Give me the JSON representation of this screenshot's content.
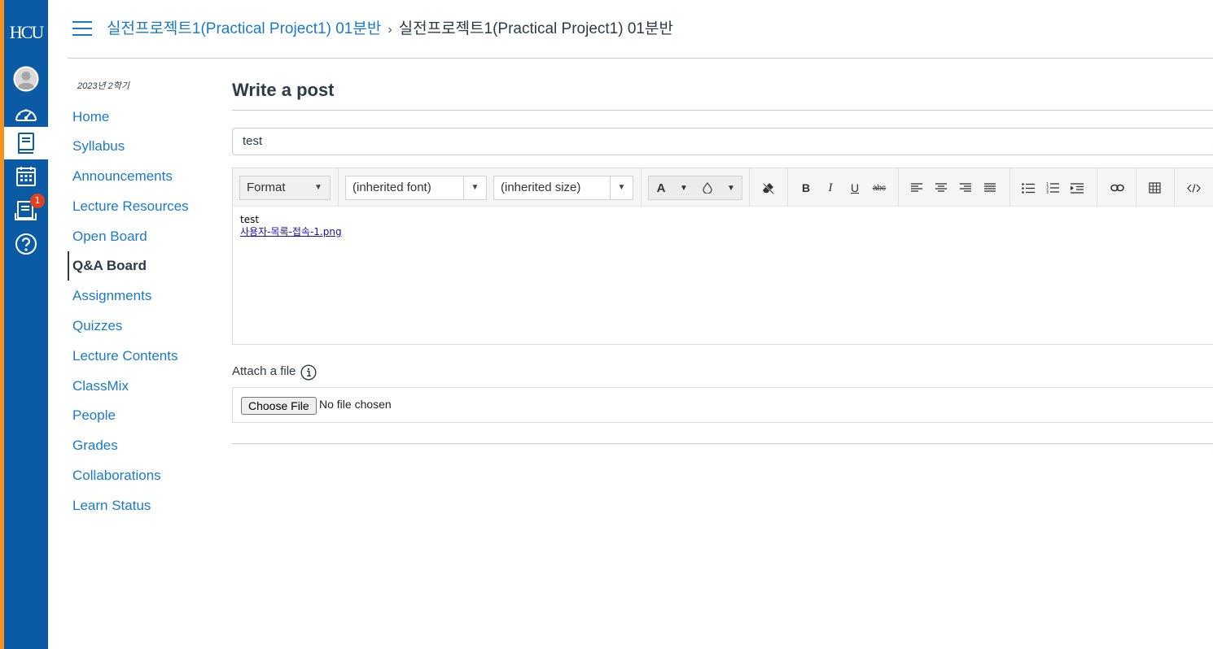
{
  "global_nav": {
    "logo": "HCU",
    "items": [
      {
        "name": "account",
        "icon": "user-avatar-icon"
      },
      {
        "name": "dashboard",
        "icon": "gauge-icon"
      },
      {
        "name": "courses",
        "icon": "book-icon",
        "active": true
      },
      {
        "name": "calendar",
        "icon": "calendar-icon"
      },
      {
        "name": "inbox",
        "icon": "inbox-icon",
        "badge": "1"
      },
      {
        "name": "help",
        "icon": "help-icon"
      }
    ],
    "colors": {
      "background": "#0a5aa5",
      "stripe": "#f5931e",
      "badge": "#e0401e"
    }
  },
  "header": {
    "breadcrumb_link": "실전프로젝트1(Practical Project1) 01분반",
    "separator": "›",
    "breadcrumb_current": "실전프로젝트1(Practical Project1) 01분반"
  },
  "course_nav": {
    "term": "2023년 2학기",
    "items": [
      {
        "label": "Home"
      },
      {
        "label": "Syllabus"
      },
      {
        "label": "Announcements"
      },
      {
        "label": "Lecture Resources"
      },
      {
        "label": "Open Board"
      },
      {
        "label": "Q&A Board",
        "active": true
      },
      {
        "label": "Assignments"
      },
      {
        "label": "Quizzes"
      },
      {
        "label": "Lecture Contents"
      },
      {
        "label": "ClassMix"
      },
      {
        "label": "People"
      },
      {
        "label": "Grades"
      },
      {
        "label": "Collaborations"
      },
      {
        "label": "Learn Status"
      }
    ]
  },
  "main": {
    "title": "Write a post",
    "title_input_value": "test",
    "toolbar": {
      "format": "Format",
      "font": "(inherited font)",
      "size": "(inherited size)",
      "text_color_letter": "A",
      "strike_label": "abc"
    },
    "editor": {
      "text": "test",
      "link": "사용자-목록-접속-1.png"
    },
    "attach_label": "Attach a file",
    "file_button": "Choose File",
    "file_status": "No file chosen"
  }
}
